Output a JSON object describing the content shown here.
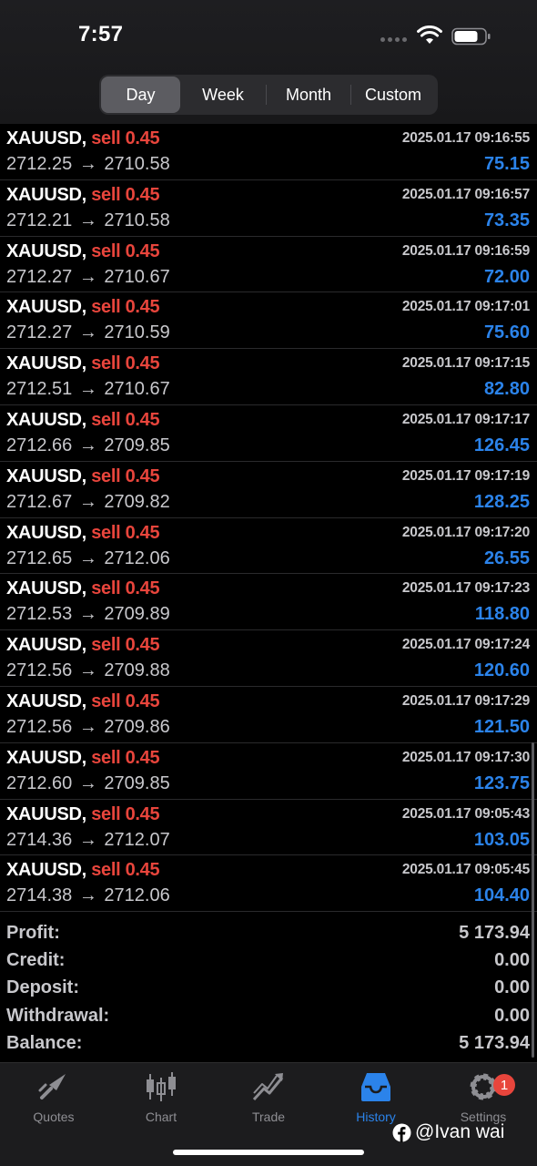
{
  "status": {
    "time": "7:57"
  },
  "periods": {
    "selected": "Day",
    "items": [
      "Day",
      "Week",
      "Month",
      "Custom"
    ]
  },
  "trades": [
    {
      "symbol": "XAUUSD,",
      "side": "sell 0.45",
      "datetime": "2025.01.17 09:16:55",
      "open": "2712.25",
      "close": "2710.58",
      "profit": "75.15"
    },
    {
      "symbol": "XAUUSD,",
      "side": "sell 0.45",
      "datetime": "2025.01.17 09:16:57",
      "open": "2712.21",
      "close": "2710.58",
      "profit": "73.35"
    },
    {
      "symbol": "XAUUSD,",
      "side": "sell 0.45",
      "datetime": "2025.01.17 09:16:59",
      "open": "2712.27",
      "close": "2710.67",
      "profit": "72.00"
    },
    {
      "symbol": "XAUUSD,",
      "side": "sell 0.45",
      "datetime": "2025.01.17 09:17:01",
      "open": "2712.27",
      "close": "2710.59",
      "profit": "75.60"
    },
    {
      "symbol": "XAUUSD,",
      "side": "sell 0.45",
      "datetime": "2025.01.17 09:17:15",
      "open": "2712.51",
      "close": "2710.67",
      "profit": "82.80"
    },
    {
      "symbol": "XAUUSD,",
      "side": "sell 0.45",
      "datetime": "2025.01.17 09:17:17",
      "open": "2712.66",
      "close": "2709.85",
      "profit": "126.45"
    },
    {
      "symbol": "XAUUSD,",
      "side": "sell 0.45",
      "datetime": "2025.01.17 09:17:19",
      "open": "2712.67",
      "close": "2709.82",
      "profit": "128.25"
    },
    {
      "symbol": "XAUUSD,",
      "side": "sell 0.45",
      "datetime": "2025.01.17 09:17:20",
      "open": "2712.65",
      "close": "2712.06",
      "profit": "26.55"
    },
    {
      "symbol": "XAUUSD,",
      "side": "sell 0.45",
      "datetime": "2025.01.17 09:17:23",
      "open": "2712.53",
      "close": "2709.89",
      "profit": "118.80"
    },
    {
      "symbol": "XAUUSD,",
      "side": "sell 0.45",
      "datetime": "2025.01.17 09:17:24",
      "open": "2712.56",
      "close": "2709.88",
      "profit": "120.60"
    },
    {
      "symbol": "XAUUSD,",
      "side": "sell 0.45",
      "datetime": "2025.01.17 09:17:29",
      "open": "2712.56",
      "close": "2709.86",
      "profit": "121.50"
    },
    {
      "symbol": "XAUUSD,",
      "side": "sell 0.45",
      "datetime": "2025.01.17 09:17:30",
      "open": "2712.60",
      "close": "2709.85",
      "profit": "123.75"
    },
    {
      "symbol": "XAUUSD,",
      "side": "sell 0.45",
      "datetime": "2025.01.17 09:05:43",
      "open": "2714.36",
      "close": "2712.07",
      "profit": "103.05"
    },
    {
      "symbol": "XAUUSD,",
      "side": "sell 0.45",
      "datetime": "2025.01.17 09:05:45",
      "open": "2714.38",
      "close": "2712.06",
      "profit": "104.40"
    }
  ],
  "arrow_glyph": "→",
  "summary": [
    {
      "label": "Profit:",
      "value": "5 173.94"
    },
    {
      "label": "Credit:",
      "value": "0.00"
    },
    {
      "label": "Deposit:",
      "value": "0.00"
    },
    {
      "label": "Withdrawal:",
      "value": "0.00"
    },
    {
      "label": "Balance:",
      "value": "5 173.94"
    }
  ],
  "tabs": [
    {
      "label": "Quotes",
      "icon": "quotes-icon"
    },
    {
      "label": "Chart",
      "icon": "chart-icon"
    },
    {
      "label": "Trade",
      "icon": "trade-icon"
    },
    {
      "label": "History",
      "icon": "history-icon",
      "active": true
    },
    {
      "label": "Settings",
      "icon": "settings-icon",
      "badge": "1"
    }
  ],
  "watermark": "@Ivan wai",
  "colors": {
    "sell": "#e8453c",
    "profit": "#2b83ea",
    "active_tab": "#2b83ea",
    "badge": "#e8453c"
  }
}
